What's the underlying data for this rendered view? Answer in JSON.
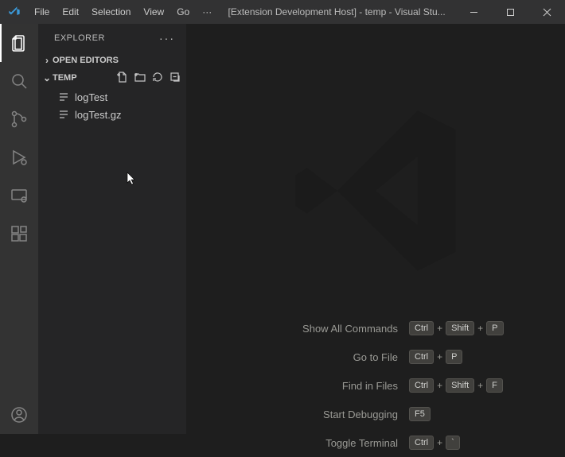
{
  "titlebar": {
    "menus": [
      "File",
      "Edit",
      "Selection",
      "View",
      "Go"
    ],
    "overflow": "···",
    "title": "[Extension Development Host] - temp - Visual Stu..."
  },
  "sidebar": {
    "title": "EXPLORER",
    "more": "···",
    "sections": {
      "openEditors": {
        "label": "OPEN EDITORS",
        "twisty": "›"
      },
      "folder": {
        "label": "TEMP",
        "twisty": "⌄"
      }
    },
    "files": [
      "logTest",
      "logTest.gz"
    ]
  },
  "welcome": {
    "rows": [
      {
        "label": "Show All Commands",
        "keys": [
          "Ctrl",
          "+",
          "Shift",
          "+",
          "P"
        ]
      },
      {
        "label": "Go to File",
        "keys": [
          "Ctrl",
          "+",
          "P"
        ]
      },
      {
        "label": "Find in Files",
        "keys": [
          "Ctrl",
          "+",
          "Shift",
          "+",
          "F"
        ]
      },
      {
        "label": "Start Debugging",
        "keys": [
          "F5"
        ]
      },
      {
        "label": "Toggle Terminal",
        "keys": [
          "Ctrl",
          "+",
          "`"
        ]
      }
    ]
  }
}
